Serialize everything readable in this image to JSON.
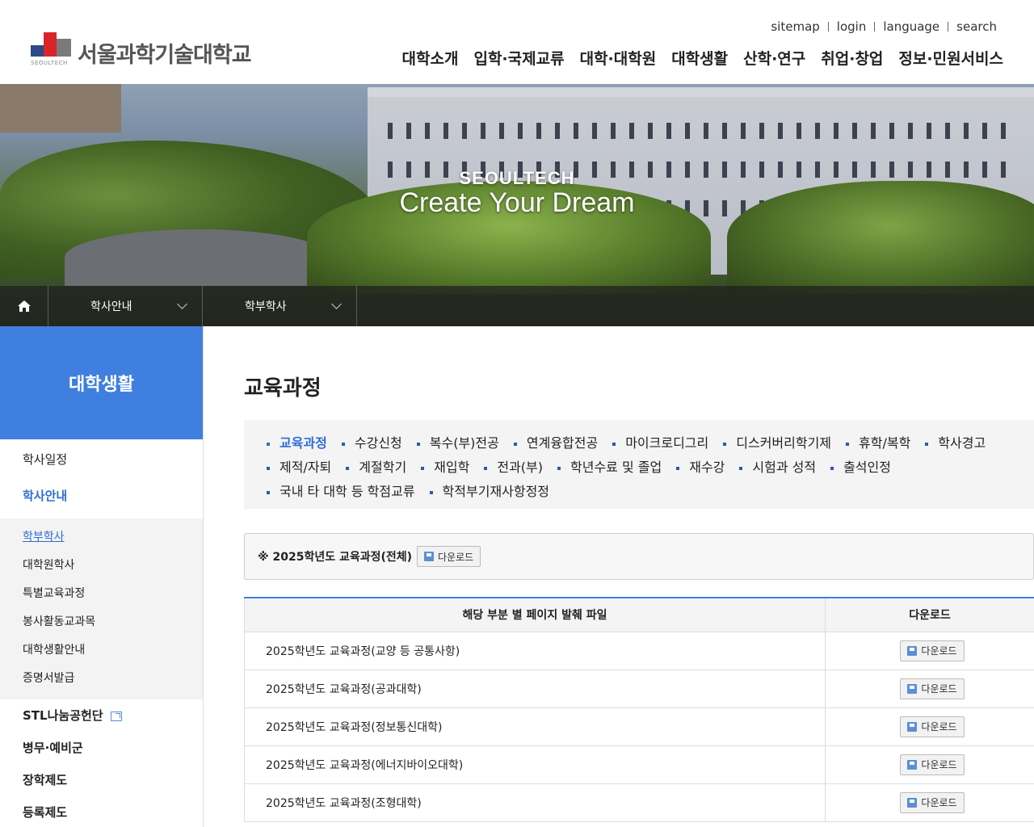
{
  "header": {
    "logo_text": "서울과학기술대학교",
    "logo_sub": "SEOULTECH",
    "util_links": [
      "sitemap",
      "login",
      "language",
      "search"
    ],
    "gnb": [
      "대학소개",
      "입학·국제교류",
      "대학·대학원",
      "대학생활",
      "산학·연구",
      "취업·창업",
      "정보·민원서비스"
    ]
  },
  "hero": {
    "sub": "SEOULTECH",
    "title": "Create Your Dream"
  },
  "location": {
    "home_icon": "home-icon",
    "dropdowns": [
      "학사안내",
      "학부학사"
    ]
  },
  "sidebar": {
    "title": "대학생활",
    "items_top": [
      {
        "label": "학사일정",
        "active": false
      },
      {
        "label": "학사안내",
        "active": true
      }
    ],
    "sub_items": [
      {
        "label": "학부학사",
        "current": true
      },
      {
        "label": "대학원학사",
        "current": false
      },
      {
        "label": "특별교육과정",
        "current": false
      },
      {
        "label": "봉사활동교과목",
        "current": false
      },
      {
        "label": "대학생활안내",
        "current": false
      },
      {
        "label": "증명서발급",
        "current": false
      }
    ],
    "items_bottom": [
      {
        "label": "STL나눔공헌단",
        "external": true
      },
      {
        "label": "병무·예비군",
        "external": false
      },
      {
        "label": "장학제도",
        "external": false
      },
      {
        "label": "등록제도",
        "external": false
      }
    ]
  },
  "content": {
    "title": "교육과정",
    "tabs": [
      {
        "label": "교육과정",
        "active": true
      },
      {
        "label": "수강신청"
      },
      {
        "label": "복수(부)전공"
      },
      {
        "label": "연계융합전공"
      },
      {
        "label": "마이크로디그리"
      },
      {
        "label": "디스커버리학기제"
      },
      {
        "label": "휴학/복학"
      },
      {
        "label": "학사경고"
      },
      {
        "label": "제적/자퇴"
      },
      {
        "label": "계절학기"
      },
      {
        "label": "재입학"
      },
      {
        "label": "전과(부)"
      },
      {
        "label": "학년수료 및 졸업"
      },
      {
        "label": "재수강"
      },
      {
        "label": "시험과 성적"
      },
      {
        "label": "출석인정"
      },
      {
        "label": "국내 타 대학 등 학점교류"
      },
      {
        "label": "학적부기재사항정정"
      }
    ],
    "full_download": {
      "label": "※ 2025학년도 교육과정(전체)",
      "button": "다운로드"
    },
    "table": {
      "headers": [
        "해당 부분 별 페이지 발췌 파일",
        "다운로드"
      ],
      "rows": [
        {
          "name": "2025학년도 교육과정(교양 등 공통사항)",
          "button": "다운로드"
        },
        {
          "name": "2025학년도 교육과정(공과대학)",
          "button": "다운로드"
        },
        {
          "name": "2025학년도 교육과정(정보통신대학)",
          "button": "다운로드"
        },
        {
          "name": "2025학년도 교육과정(에너지바이오대학)",
          "button": "다운로드"
        },
        {
          "name": "2025학년도 교육과정(조형대학)",
          "button": "다운로드"
        }
      ]
    }
  },
  "colors": {
    "accent": "#3f7fe0",
    "active_text": "#2f6dd6",
    "brand_red": "#d9242b",
    "brand_blue": "#2c4a8a"
  }
}
